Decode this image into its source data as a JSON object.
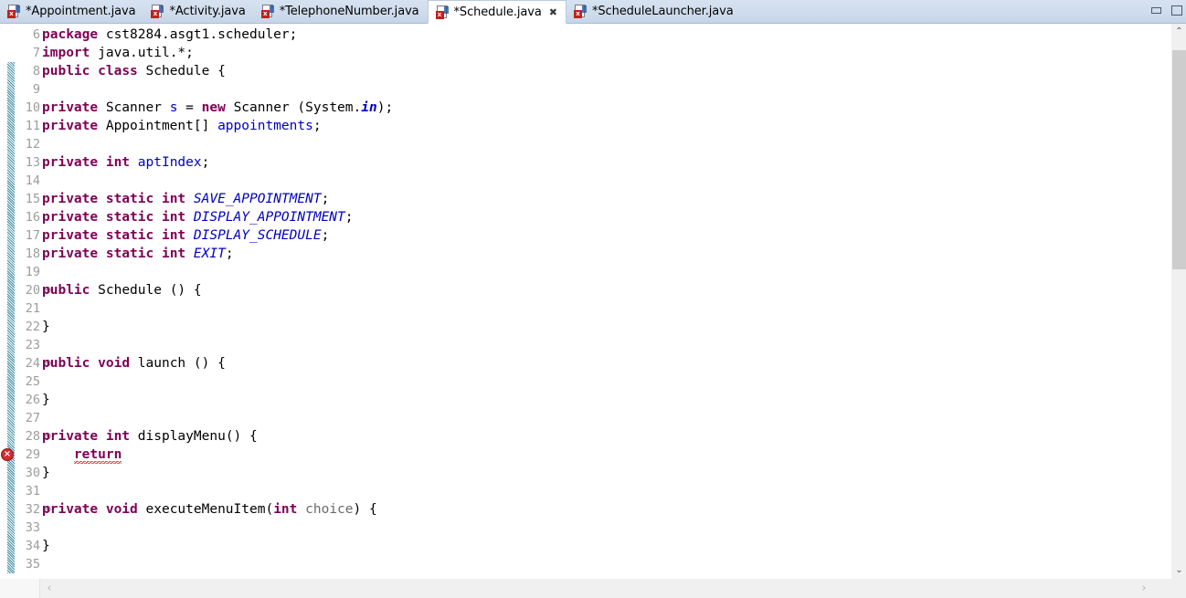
{
  "window": {
    "minimize_icon": "minimize-icon",
    "maximize_icon": "maximize-icon"
  },
  "tabs": [
    {
      "label": "*Appointment.java",
      "icon": "java-file-icon",
      "active": false,
      "dirty": true
    },
    {
      "label": "*Activity.java",
      "icon": "java-file-icon",
      "active": false,
      "dirty": true
    },
    {
      "label": "*TelephoneNumber.java",
      "icon": "java-file-icon",
      "active": false,
      "dirty": true
    },
    {
      "label": "*Schedule.java",
      "icon": "java-file-icon",
      "active": true,
      "dirty": true,
      "close_glyph": "✖"
    },
    {
      "label": "*ScheduleLauncher.java",
      "icon": "java-file-icon",
      "active": false,
      "dirty": true
    }
  ],
  "editor": {
    "first_line_number": 6,
    "last_line_number": 35,
    "line_numbers": [
      6,
      7,
      8,
      9,
      10,
      11,
      12,
      13,
      14,
      15,
      16,
      17,
      18,
      19,
      20,
      21,
      22,
      23,
      24,
      25,
      26,
      27,
      28,
      29,
      30,
      31,
      32,
      33,
      34,
      35
    ],
    "folding_markers": [
      {
        "line": 20,
        "glyph": "⊖"
      },
      {
        "line": 24,
        "glyph": "⊖"
      },
      {
        "line": 28,
        "glyph": "⊖"
      },
      {
        "line": 32,
        "glyph": "⊖"
      }
    ],
    "error_markers": [
      {
        "line": 29,
        "type": "error",
        "glyph": "×"
      }
    ],
    "change_bar": {
      "from_line": 8,
      "to_line": 35
    },
    "lines": [
      {
        "n": 6,
        "text": "package cst8284.asgt1.scheduler;"
      },
      {
        "n": 7,
        "text": "import java.util.*;"
      },
      {
        "n": 8,
        "text": "public class Schedule {"
      },
      {
        "n": 9,
        "text": ""
      },
      {
        "n": 10,
        "text": "private Scanner s = new Scanner (System.in);"
      },
      {
        "n": 11,
        "text": "private Appointment[] appointments;"
      },
      {
        "n": 12,
        "text": ""
      },
      {
        "n": 13,
        "text": "private int aptIndex;"
      },
      {
        "n": 14,
        "text": ""
      },
      {
        "n": 15,
        "text": "private static int SAVE_APPOINTMENT;"
      },
      {
        "n": 16,
        "text": "private static int DISPLAY_APPOINTMENT;"
      },
      {
        "n": 17,
        "text": "private static int DISPLAY_SCHEDULE;"
      },
      {
        "n": 18,
        "text": "private static int EXIT;"
      },
      {
        "n": 19,
        "text": ""
      },
      {
        "n": 20,
        "text": "public Schedule () {"
      },
      {
        "n": 21,
        "text": ""
      },
      {
        "n": 22,
        "text": "}"
      },
      {
        "n": 23,
        "text": ""
      },
      {
        "n": 24,
        "text": "public void launch () {"
      },
      {
        "n": 25,
        "text": ""
      },
      {
        "n": 26,
        "text": "}"
      },
      {
        "n": 27,
        "text": ""
      },
      {
        "n": 28,
        "text": "private int displayMenu() {"
      },
      {
        "n": 29,
        "text": "    return"
      },
      {
        "n": 30,
        "text": "}"
      },
      {
        "n": 31,
        "text": ""
      },
      {
        "n": 32,
        "text": "private void executeMenuItem(int choice) {"
      },
      {
        "n": 33,
        "text": ""
      },
      {
        "n": 34,
        "text": "}"
      },
      {
        "n": 35,
        "text": ""
      }
    ]
  },
  "scrollbars": {
    "vertical": {
      "up_arrow": "⌃",
      "down_arrow": "⌄"
    },
    "horizontal": {
      "left_arrow": "‹",
      "right_arrow": "›"
    }
  },
  "colors": {
    "keyword": "#7f0055",
    "field": "#0000c0",
    "static_field": "#0000c0",
    "parameter": "#6a6a6a",
    "error": "#d32b2b",
    "tabbar": "#cfdcec",
    "active_tab": "#ffffff",
    "change_bar": "#6fb4c7",
    "line_number": "#9c9c9c"
  }
}
